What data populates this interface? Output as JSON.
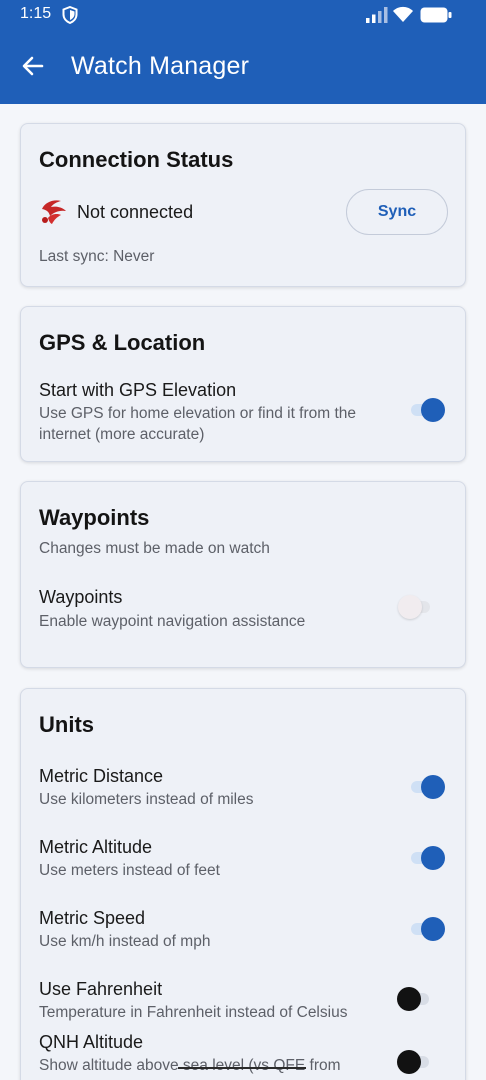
{
  "status_bar": {
    "time": "1:15"
  },
  "app_bar": {
    "title": "Watch Manager"
  },
  "connection": {
    "title": "Connection Status",
    "status": "Not connected",
    "sync_label": "Sync",
    "last_sync": "Last sync: Never"
  },
  "gps": {
    "title": "GPS & Location",
    "setting": {
      "title": "Start with GPS Elevation",
      "subtitle_line1": "Use GPS for home elevation or find it from the",
      "subtitle_line2": "internet (more accurate)",
      "enabled": true
    }
  },
  "waypoints": {
    "title": "Waypoints",
    "note": "Changes must be made on watch",
    "setting": {
      "title": "Waypoints",
      "subtitle": "Enable waypoint navigation assistance",
      "enabled": false,
      "disabled": true
    }
  },
  "units": {
    "title": "Units",
    "items": [
      {
        "title": "Metric Distance",
        "subtitle": "Use kilometers instead of miles",
        "enabled": true
      },
      {
        "title": "Metric Altitude",
        "subtitle": "Use meters instead of feet",
        "enabled": true
      },
      {
        "title": "Metric Speed",
        "subtitle": "Use km/h instead of mph",
        "enabled": true
      },
      {
        "title": "Use Fahrenheit",
        "subtitle": "Temperature in Fahrenheit instead of Celsius",
        "enabled": false
      },
      {
        "title": "QNH Altitude",
        "subtitle": "Show altitude above sea level (vs QFE from",
        "enabled": false
      }
    ]
  }
}
